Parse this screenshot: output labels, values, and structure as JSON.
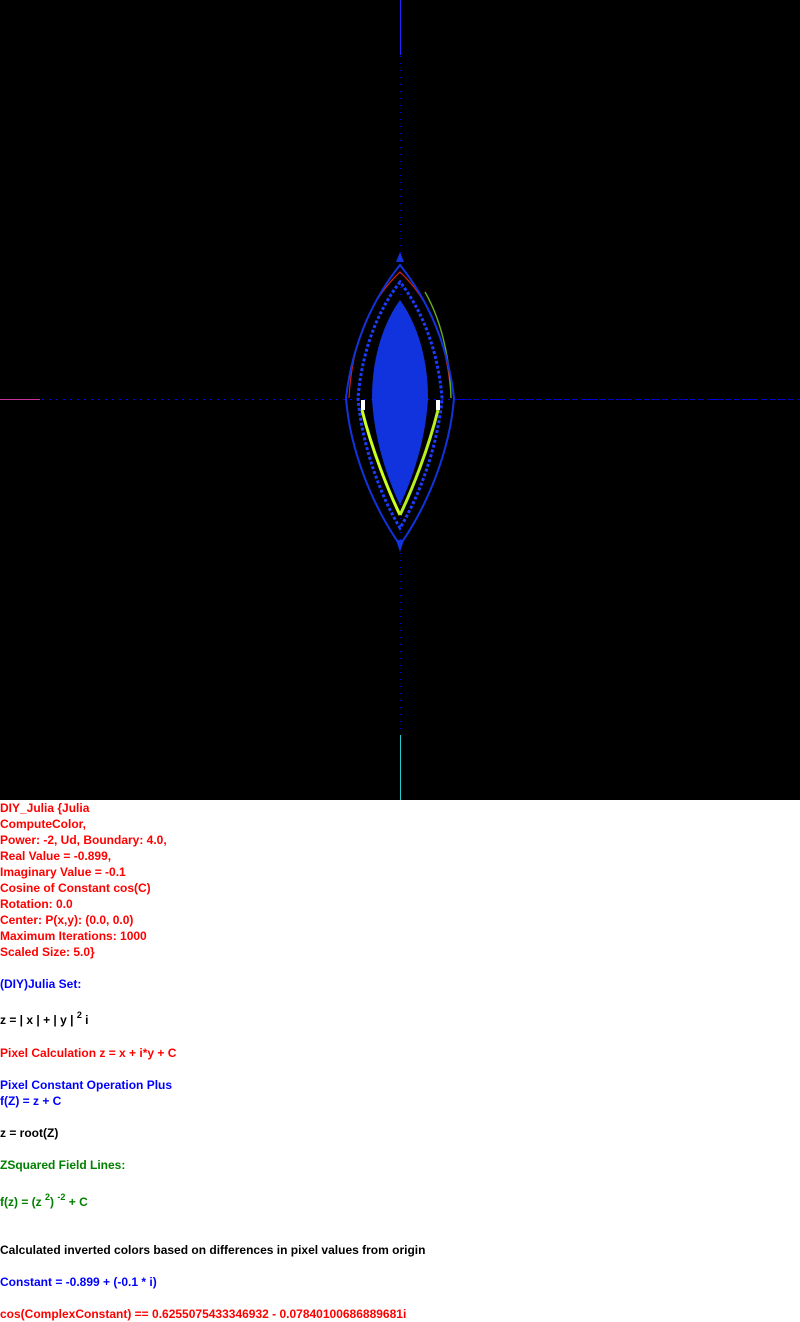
{
  "params": {
    "line1": "DIY_Julia {Julia",
    "line2": "ComputeColor,",
    "line3": "Power: -2, Ud, Boundary: 4.0,",
    "line4": "Real Value = -0.899,",
    "line5": "Imaginary Value = -0.1",
    "line6": "Cosine of Constant cos(C)",
    "line7": "Rotation: 0.0",
    "line8": "Center: P(x,y): (0.0, 0.0)",
    "line9": "Maximum Iterations: 1000",
    "line10": "Scaled Size: 5.0}"
  },
  "set_title": "(DIY)Julia Set:",
  "z_formula": {
    "base": "z = | x | + | y |",
    "exp": "2",
    "tail": "i"
  },
  "pixel_calc": "Pixel Calculation z = x + i*y + C",
  "pixel_op": "Pixel Constant Operation Plus",
  "f_formula": "f(Z) = z + C",
  "root_formula": "z = root(Z)",
  "field_lines": "ZSquared Field Lines:",
  "fz_formula": {
    "a": "f(z) = (z",
    "e1": "2",
    "b": ")",
    "e2": "-2",
    "c": "+ C"
  },
  "colors_note": "Calculated inverted colors based on differences in pixel values from origin",
  "constant": "Constant = -0.899 + (-0.1 * i)",
  "cos_constant": "cos(ComplexConstant) == 0.6255075433346932 - 0.07840100686889681i",
  "colors": {
    "background": "#000000",
    "set_fill": "#1133dd",
    "axis": "#0000ff",
    "arc_red": "#cc2200",
    "arc_green": "#66aa22",
    "yellow_green": "#ccff22"
  }
}
